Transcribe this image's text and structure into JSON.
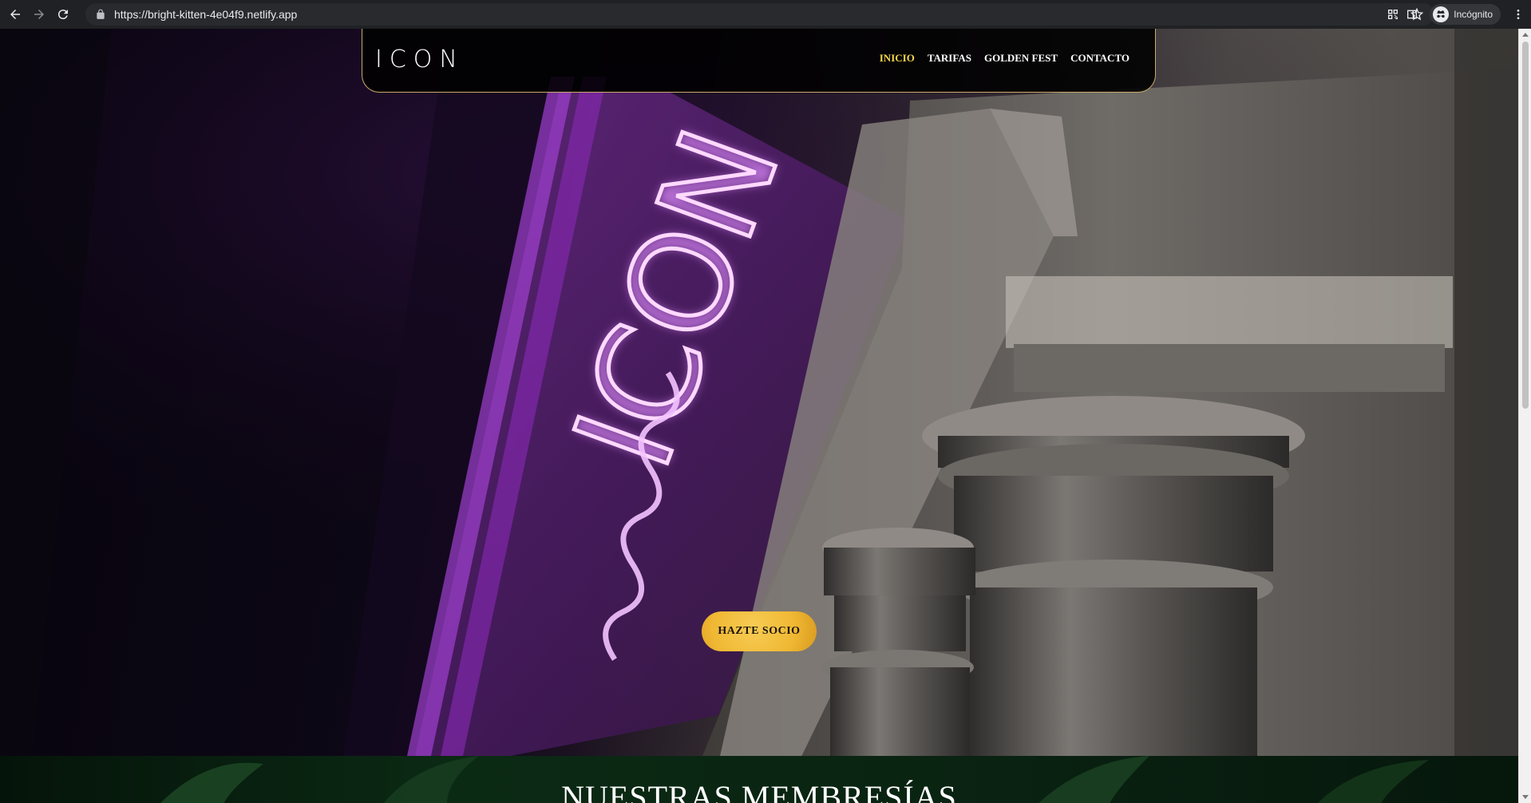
{
  "browser": {
    "url": "https://bright-kitten-4e04f9.netlify.app",
    "profile_label": "Incógnito"
  },
  "site": {
    "logo": "ICON",
    "nav": [
      {
        "label": "INICIO",
        "active": true
      },
      {
        "label": "TARIFAS",
        "active": false
      },
      {
        "label": "GOLDEN FEST",
        "active": false
      },
      {
        "label": "CONTACTO",
        "active": false
      }
    ],
    "cta_label": "HAZTE SOCIO",
    "section_title": "NUESTRAS MEMBRESÍAS"
  },
  "colors": {
    "accent": "#f4d64c",
    "cta": "#f0b833",
    "header_border": "#c9a96a",
    "neon": "#d36bff"
  }
}
